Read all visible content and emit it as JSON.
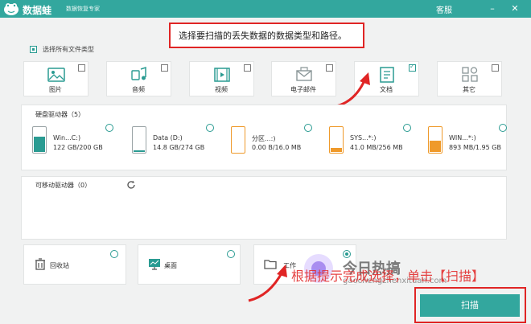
{
  "titlebar": {
    "app_name": "数据蛙",
    "subtitle": "数据恢复专家",
    "help": "客服",
    "minimize": "–",
    "close": "✕"
  },
  "hint": "选择要扫描的丢失数据的数据类型和路径。",
  "select_all": "选择所有文件类型",
  "file_types": [
    {
      "label": "图片",
      "icon": "image-icon",
      "checked": false
    },
    {
      "label": "音频",
      "icon": "music-icon",
      "checked": false
    },
    {
      "label": "视频",
      "icon": "video-icon",
      "checked": false
    },
    {
      "label": "电子邮件",
      "icon": "mail-icon",
      "checked": false
    },
    {
      "label": "文档",
      "icon": "document-icon",
      "checked": true
    },
    {
      "label": "其它",
      "icon": "other-icon",
      "checked": false
    }
  ],
  "hdd_section": {
    "title": "硬盘驱动器（5）",
    "drives": [
      {
        "name": "Win...C:)",
        "size": "122 GB/200 GB",
        "fill": 0.6,
        "color": "#2a9b92"
      },
      {
        "name": "Data (D:)",
        "size": "14.8 GB/274 GB",
        "fill": 0.05,
        "color": "#2a9b92"
      },
      {
        "name": "分区...:)",
        "size": "0.00  B/16.0 MB",
        "fill": 0.0,
        "color": "#ef9a2b"
      },
      {
        "name": "SYS...*:)",
        "size": "41.0 MB/256 MB",
        "fill": 0.16,
        "color": "#ef9a2b"
      },
      {
        "name": "WIN...*:)",
        "size": "893 MB/1.95 GB",
        "fill": 0.45,
        "color": "#ef9a2b"
      }
    ]
  },
  "removable_section": {
    "title": "可移动驱动器（0）"
  },
  "locations": [
    {
      "label": "回收站",
      "icon": "recycle-bin-icon"
    },
    {
      "label": "桌面",
      "icon": "desktop-icon"
    },
    {
      "label": "工作",
      "icon": "folder-icon"
    }
  ],
  "scan_button": "扫描",
  "annotation": "根据提示完成选择，单击【扫描】",
  "watermark": {
    "brand": "今日热搞",
    "url": "gaochengzhenxituan.com"
  },
  "colors": {
    "accent": "#33a79e",
    "highlight": "#e02525",
    "warning": "#ef9a2b"
  }
}
